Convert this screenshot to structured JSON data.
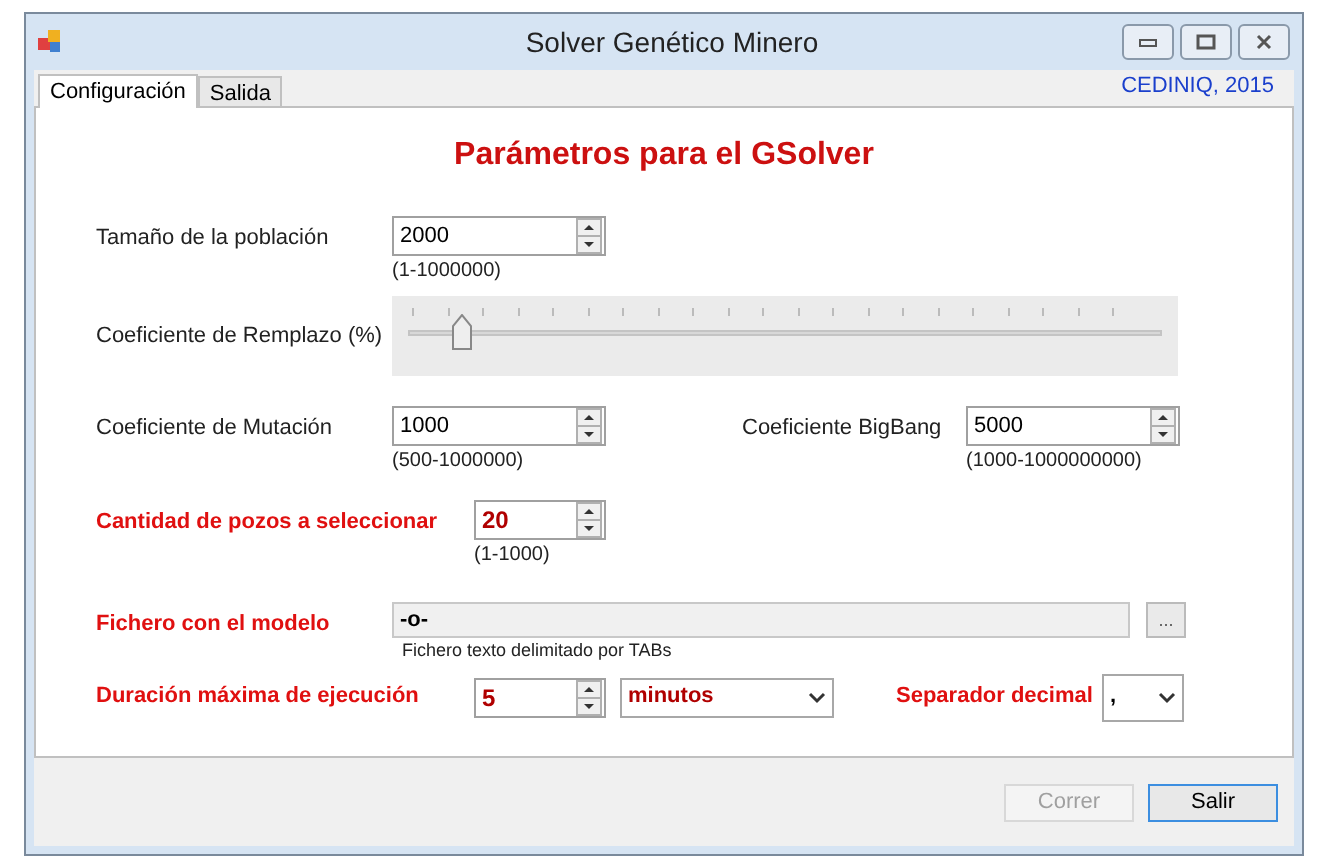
{
  "window": {
    "title": "Solver Genético Minero"
  },
  "tabs": [
    {
      "label": "Configuración",
      "selected": true
    },
    {
      "label": "Salida",
      "selected": false
    }
  ],
  "credit": "CEDINIQ, 2015",
  "heading": "Parámetros para el GSolver",
  "population": {
    "label": "Tamaño de la población",
    "value": "2000",
    "range": "(1-1000000)",
    "highlighted": false
  },
  "replacement": {
    "label": "Coeficiente de Remplazo (%)",
    "level": 0.06
  },
  "mutation": {
    "label": "Coeficiente de Mutación",
    "value": "1000",
    "range": "(500-1000000)",
    "highlighted": false
  },
  "bigbang": {
    "label": "Coeficiente BigBang",
    "value": "5000",
    "range": "(1000-1000000000)",
    "highlighted": false
  },
  "wells": {
    "label": "Cantidad de pozos a seleccionar",
    "value": "20",
    "range": "(1-1000)",
    "highlighted": true
  },
  "model_file": {
    "label": "Fichero con el modelo",
    "value": "-o-",
    "browse": "...",
    "hint": "Fichero texto delimitado por TABs"
  },
  "duration": {
    "label": "Duración máxima de ejecución",
    "value": "5",
    "unit": "minutos",
    "highlighted": true
  },
  "decimal_separator": {
    "label": "Separador decimal",
    "value": ","
  },
  "buttons": [
    {
      "label": "Correr",
      "disabled": true
    },
    {
      "label": "Salir",
      "disabled": false
    }
  ]
}
